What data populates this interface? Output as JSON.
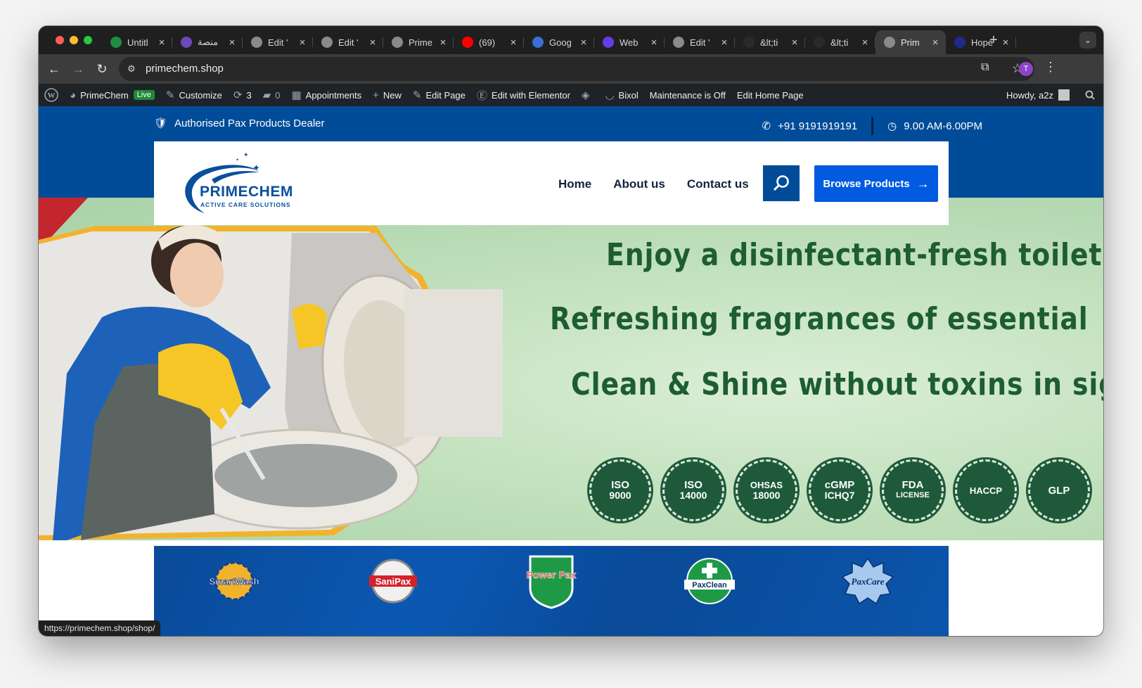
{
  "browser": {
    "tabs": [
      {
        "title": "Untitl",
        "icon": "sheets-icon",
        "color": "#1e8e3e"
      },
      {
        "title": "منصة",
        "icon": "site-icon",
        "color": "#6b4bb8"
      },
      {
        "title": "Edit '",
        "icon": "wordpress-icon",
        "color": "#8a8a8a"
      },
      {
        "title": "Edit '",
        "icon": "wordpress-icon",
        "color": "#8a8a8a"
      },
      {
        "title": "Prime",
        "icon": "wordpress-icon",
        "color": "#8a8a8a"
      },
      {
        "title": "(69)",
        "icon": "youtube-icon",
        "color": "#ff0000"
      },
      {
        "title": "Goog",
        "icon": "google-forms-icon",
        "color": "#3b6fd6"
      },
      {
        "title": "Web",
        "icon": "hostinger-icon",
        "color": "#673de6"
      },
      {
        "title": "Edit '",
        "icon": "wordpress-icon",
        "color": "#8a8a8a"
      },
      {
        "title": "&lt;ti",
        "icon": "blank-icon",
        "color": "#2a2a2a"
      },
      {
        "title": "&lt;ti",
        "icon": "blank-icon",
        "color": "#2a2a2a"
      },
      {
        "title": "Prim",
        "icon": "globe-icon",
        "color": "#8a8a8a",
        "active": true
      },
      {
        "title": "Hope",
        "icon": "site-icon",
        "color": "#202a8a"
      }
    ],
    "url": "primechem.shop",
    "profile_initial": "T",
    "status_url": "https://primechem.shop/shop/"
  },
  "wp_admin_bar": {
    "site_name": "PrimeChem",
    "live_label": "Live",
    "customize": "Customize",
    "updates_count": "3",
    "comments_count": "0",
    "appointments": "Appointments",
    "new": "New",
    "edit_page": "Edit Page",
    "edit_elementor": "Edit with Elementor",
    "bixol": "Bixol",
    "maintenance": "Maintenance is Off",
    "edit_home": "Edit Home Page",
    "howdy": "Howdy, a2z"
  },
  "site": {
    "topbar": {
      "dealer_text": "Authorised Pax Products Dealer",
      "phone": "+91 9191919191",
      "hours": "9.00 AM-6.00PM"
    },
    "logo": {
      "name": "PRIMECHEM",
      "tagline": "ACTIVE CARE SOLUTIONS"
    },
    "nav": [
      "Home",
      "About us",
      "Contact us"
    ],
    "browse_button": "Browse Products",
    "hero": {
      "line1": "Enjoy a disinfectant-fresh toilet,",
      "line2": "Refreshing  fragrances of essential",
      "line3": "Clean & Shine without toxins in sig",
      "certifications": [
        {
          "top": "ISO",
          "bottom": "9000"
        },
        {
          "top": "ISO",
          "bottom": "14000"
        },
        {
          "top": "OHSAS",
          "bottom": "18000"
        },
        {
          "top": "cGMP",
          "bottom": "ICHQ7"
        },
        {
          "top": "FDA",
          "bottom": "LICENSE"
        },
        {
          "top": "HACCP",
          "bottom": ""
        },
        {
          "top": "GLP",
          "bottom": ""
        }
      ]
    },
    "brands": [
      "SmartWash",
      "SaniPax",
      "Power Pax",
      "PaxClean",
      "PaxCare"
    ]
  },
  "colors": {
    "primary_blue": "#004c99",
    "button_blue": "#005be0",
    "hero_text": "#1d5d31"
  }
}
